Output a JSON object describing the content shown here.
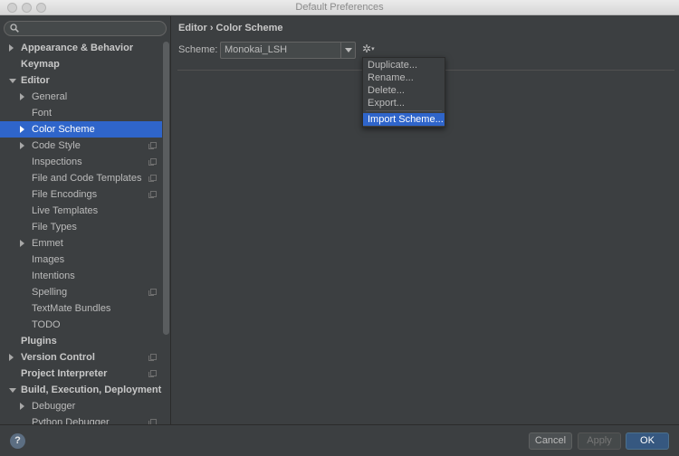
{
  "window": {
    "title": "Default Preferences"
  },
  "search": {
    "placeholder": ""
  },
  "sidebar": {
    "items": [
      {
        "label": "Appearance & Behavior",
        "level": 0,
        "bold": true,
        "arrow": "right"
      },
      {
        "label": "Keymap",
        "level": 0,
        "bold": true,
        "arrow": "none"
      },
      {
        "label": "Editor",
        "level": 0,
        "bold": true,
        "arrow": "down"
      },
      {
        "label": "General",
        "level": 1,
        "bold": false,
        "arrow": "right"
      },
      {
        "label": "Font",
        "level": 1,
        "bold": false,
        "arrow": "none"
      },
      {
        "label": "Color Scheme",
        "level": 1,
        "bold": false,
        "arrow": "right",
        "selected": true
      },
      {
        "label": "Code Style",
        "level": 1,
        "bold": false,
        "arrow": "right",
        "copy": true
      },
      {
        "label": "Inspections",
        "level": 1,
        "bold": false,
        "arrow": "none",
        "copy": true
      },
      {
        "label": "File and Code Templates",
        "level": 1,
        "bold": false,
        "arrow": "none",
        "copy": true
      },
      {
        "label": "File Encodings",
        "level": 1,
        "bold": false,
        "arrow": "none",
        "copy": true
      },
      {
        "label": "Live Templates",
        "level": 1,
        "bold": false,
        "arrow": "none"
      },
      {
        "label": "File Types",
        "level": 1,
        "bold": false,
        "arrow": "none"
      },
      {
        "label": "Emmet",
        "level": 1,
        "bold": false,
        "arrow": "right"
      },
      {
        "label": "Images",
        "level": 1,
        "bold": false,
        "arrow": "none"
      },
      {
        "label": "Intentions",
        "level": 1,
        "bold": false,
        "arrow": "none"
      },
      {
        "label": "Spelling",
        "level": 1,
        "bold": false,
        "arrow": "none",
        "copy": true
      },
      {
        "label": "TextMate Bundles",
        "level": 1,
        "bold": false,
        "arrow": "none"
      },
      {
        "label": "TODO",
        "level": 1,
        "bold": false,
        "arrow": "none"
      },
      {
        "label": "Plugins",
        "level": 0,
        "bold": true,
        "arrow": "none"
      },
      {
        "label": "Version Control",
        "level": 0,
        "bold": true,
        "arrow": "right",
        "copy": true
      },
      {
        "label": "Project Interpreter",
        "level": 0,
        "bold": true,
        "arrow": "none",
        "copy": true
      },
      {
        "label": "Build, Execution, Deployment",
        "level": 0,
        "bold": true,
        "arrow": "down"
      },
      {
        "label": "Debugger",
        "level": 1,
        "bold": false,
        "arrow": "right"
      },
      {
        "label": "Python Debugger",
        "level": 1,
        "bold": false,
        "arrow": "none",
        "copy": true
      }
    ]
  },
  "main": {
    "breadcrumb": "Editor › Color Scheme",
    "scheme_label": "Scheme:",
    "scheme_value": "Monokai_LSH",
    "gear_icon": "gear-icon"
  },
  "menu": {
    "items": [
      {
        "label": "Duplicate..."
      },
      {
        "label": "Rename..."
      },
      {
        "label": "Delete..."
      },
      {
        "label": "Export..."
      },
      {
        "label": "Import Scheme...",
        "selected": true
      }
    ]
  },
  "footer": {
    "help_label": "?",
    "cancel_label": "Cancel",
    "apply_label": "Apply",
    "ok_label": "OK"
  },
  "colors": {
    "selection": "#2f65ca",
    "background": "#3c3f41",
    "ok_button": "#365880"
  }
}
